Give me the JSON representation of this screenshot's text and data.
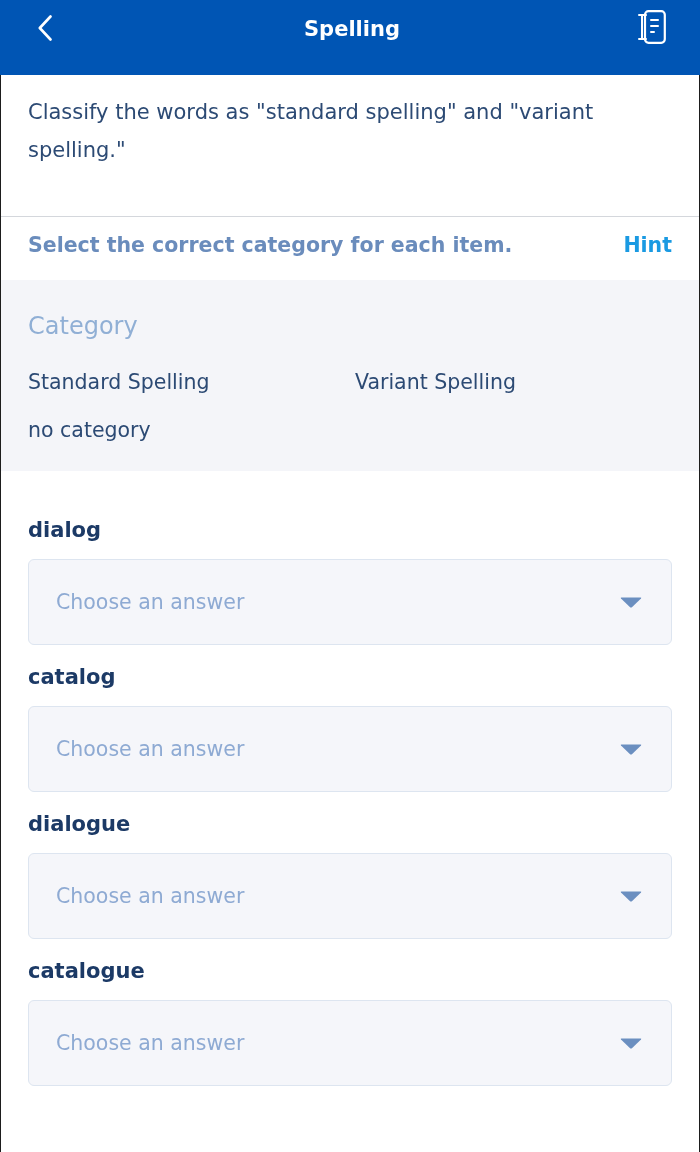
{
  "header": {
    "title": "Spelling"
  },
  "instructions": "Classify the words as \"standard spelling\" and \"variant spelling.\"",
  "prompt": {
    "text": "Select the correct category for each item.",
    "hint": "Hint"
  },
  "category_panel": {
    "heading": "Category",
    "options": [
      "Standard Spelling",
      "Variant Spelling",
      "no category"
    ]
  },
  "items": [
    {
      "word": "dialog",
      "placeholder": "Choose an answer"
    },
    {
      "word": "catalog",
      "placeholder": "Choose an answer"
    },
    {
      "word": "dialogue",
      "placeholder": "Choose an answer"
    },
    {
      "word": "catalogue",
      "placeholder": "Choose an answer"
    }
  ]
}
